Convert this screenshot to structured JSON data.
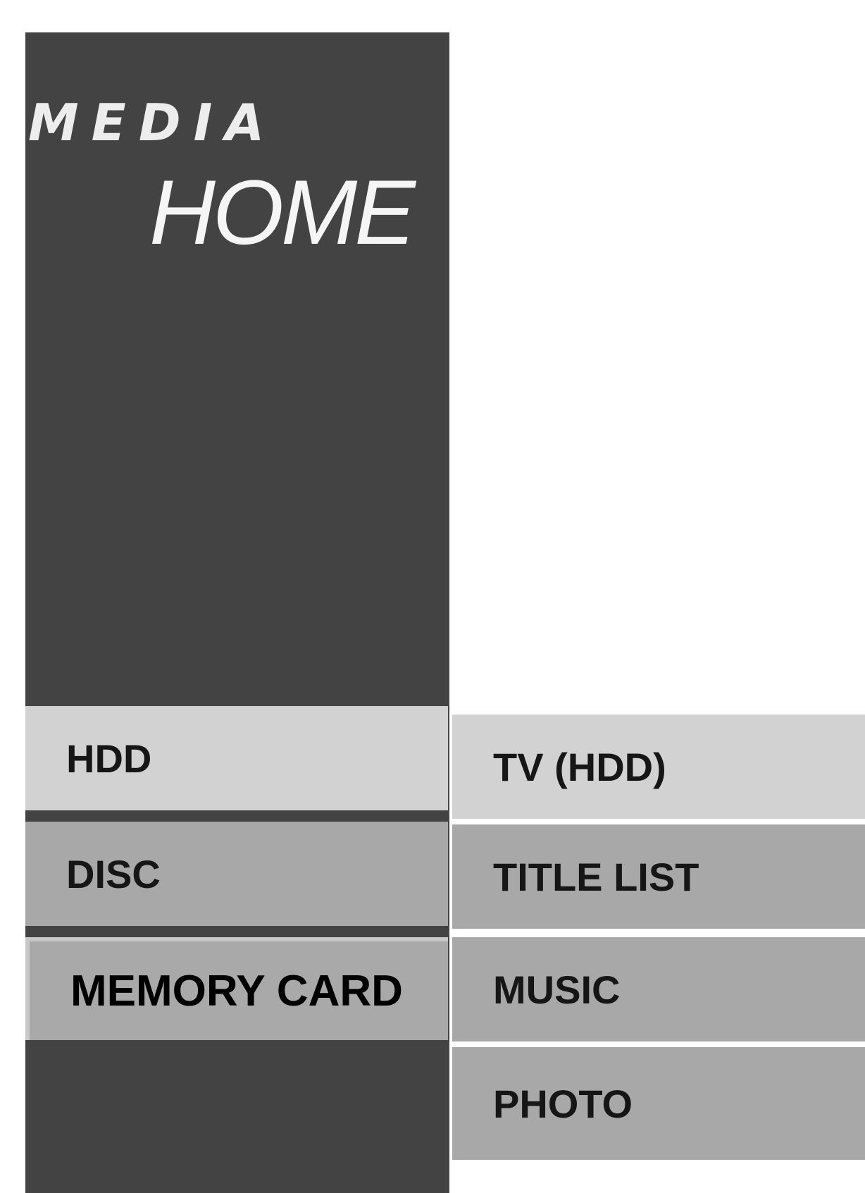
{
  "header": {
    "brand_line1": "MEDIA",
    "brand_line2": "HOME"
  },
  "primary_menu": {
    "items": [
      {
        "label": "HDD"
      },
      {
        "label": "DISC"
      },
      {
        "label": "MEMORY CARD"
      }
    ],
    "selected": "MEMORY CARD"
  },
  "secondary_menu": {
    "items": [
      {
        "label": "TV (HDD)"
      },
      {
        "label": "TITLE LIST"
      },
      {
        "label": "MUSIC"
      },
      {
        "label": "PHOTO"
      }
    ]
  },
  "colors": {
    "panel": "#434343",
    "item_light": "#d2d2d2",
    "item_mid": "#a8a8a8",
    "text": "#161616",
    "background": "#ffffff"
  }
}
